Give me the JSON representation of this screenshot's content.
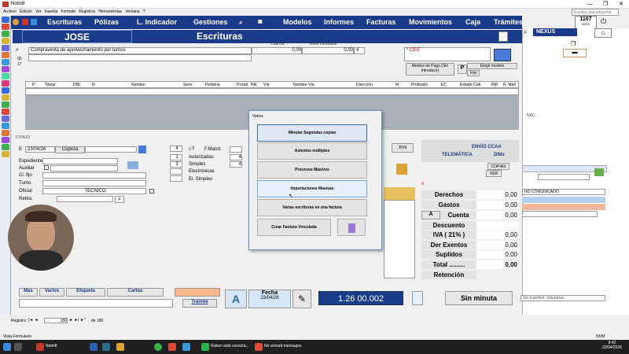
{
  "window": {
    "title": "Notin8",
    "controls": [
      "—",
      "❐",
      "✕"
    ]
  },
  "menu": [
    "Archivo",
    "Edición",
    "Ver",
    "Insertar",
    "Formato",
    "Registros",
    "Herramientas",
    "Ventana",
    "?"
  ],
  "nav": [
    "Escrituras",
    "Pólizas",
    "L. Indicador",
    "Gestiones",
    "Modelos",
    "Informes",
    "Facturas",
    "Movimientos",
    "Caja",
    "Trámites"
  ],
  "search_placeholder": "Escriba una pregunta",
  "counter": {
    "value": "1107",
    "date": "02/01"
  },
  "user": "JOSE",
  "section_title": "Escrituras",
  "top_form": {
    "cuantia_label": "Cuantía",
    "base_label": "Base minutable",
    "concepto": "Compraventa de aprovechamiento por turnos",
    "cuantia": "0,00",
    "base": "0,00",
    "num": "4",
    "code_05": "05",
    "code_17": "17"
  },
  "ces": "*.CES",
  "medios_pago": "Medios de Pago (Sin Introducir)",
  "elegir_modelo": "Elegir modelo",
  "imp": "Imp",
  "nexus": "NEXUS",
  "grid_headers": [
    "P",
    "Titular",
    "DNI",
    "N",
    "Nombre",
    "Sexo",
    "Pedanía",
    "Postal",
    "NR",
    "Vía",
    "Nombre Vía",
    "Dirección",
    "M",
    "Profesión",
    "EC",
    "Estado Civil",
    "RM",
    "R. Matr"
  ],
  "itp": "ITP.AJD",
  "left_form": {
    "e": "E",
    "fecha": "23/04/26",
    "copista": "Copista",
    "expediente": "Expediente",
    "auxiliar": "Auxiliar",
    "cl_fijo": "Cl. fijo",
    "turno": "Turno",
    "oficial": "Oficial",
    "oficial_val": "TECNICO",
    "retira": "Retira:"
  },
  "mid_form": {
    "n4": "4",
    "e0": "¿:0",
    "fmatriz": "F.Matriz",
    "n1": "1",
    "autorizadas": "Autorizadas",
    "a4": "4",
    "n3": "3",
    "simples": "Simples",
    "s4": "4",
    "electronicas": "Electrónicas",
    "el_simples": "El. Simples"
  },
  "xml": "Xml",
  "envio_ccaa": "ENVÍO CCAA",
  "telematica": "TELEMÁTICA",
  "dnis": "DNIs",
  "copias": "COPIAS",
  "ver": "VER",
  "zero": "0",
  "nac": "NAC:",
  "no_comunicado": "NO COMUNICADO",
  "sin_manifest": "Sin manifest. tributarias",
  "totals": [
    {
      "label": "Derechos",
      "value": "0,00"
    },
    {
      "label": "Gastos",
      "value": "0,00"
    },
    {
      "label": "Cuenta",
      "value": "0,00"
    },
    {
      "label": "Descuento",
      "value": ""
    },
    {
      "label": "IVA (    21%  )",
      "value": "0,00"
    },
    {
      "label": "Der Exentos",
      "value": "0,00"
    },
    {
      "label": "Suplidos",
      "value": "0,00"
    },
    {
      "label": "Total .........",
      "value": "0,00"
    },
    {
      "label": "Retención",
      "value": ""
    }
  ],
  "a_label": "A",
  "dialog": {
    "title": "Varios",
    "buttons": [
      "Minutar Segundas copias",
      "Asientos múltiples",
      "Procesos Masivos",
      "Importaciones Masivas",
      "Varias escrituras en una factura",
      "Crear Factura Vinculada"
    ]
  },
  "bottom": {
    "tabs": [
      "Mas",
      "Varios",
      "Etiqueta",
      "Cartas"
    ],
    "tramite": "Trámite",
    "a_big": "A",
    "fecha_label": "Fecha",
    "fecha": "23/04/26",
    "protocolo": "1.26 00.002",
    "sin_minuta": "Sin minuta"
  },
  "record": {
    "label": "Registro:",
    "current": "186",
    "of": "de 186"
  },
  "status": {
    "left": "Vista Formulario",
    "right": "NUM"
  },
  "taskbar": {
    "app1": "Notin8",
    "app2": "Ruben está conecta...",
    "app3": "No unread messages",
    "time": "8:42",
    "date": "23/04/2026"
  }
}
